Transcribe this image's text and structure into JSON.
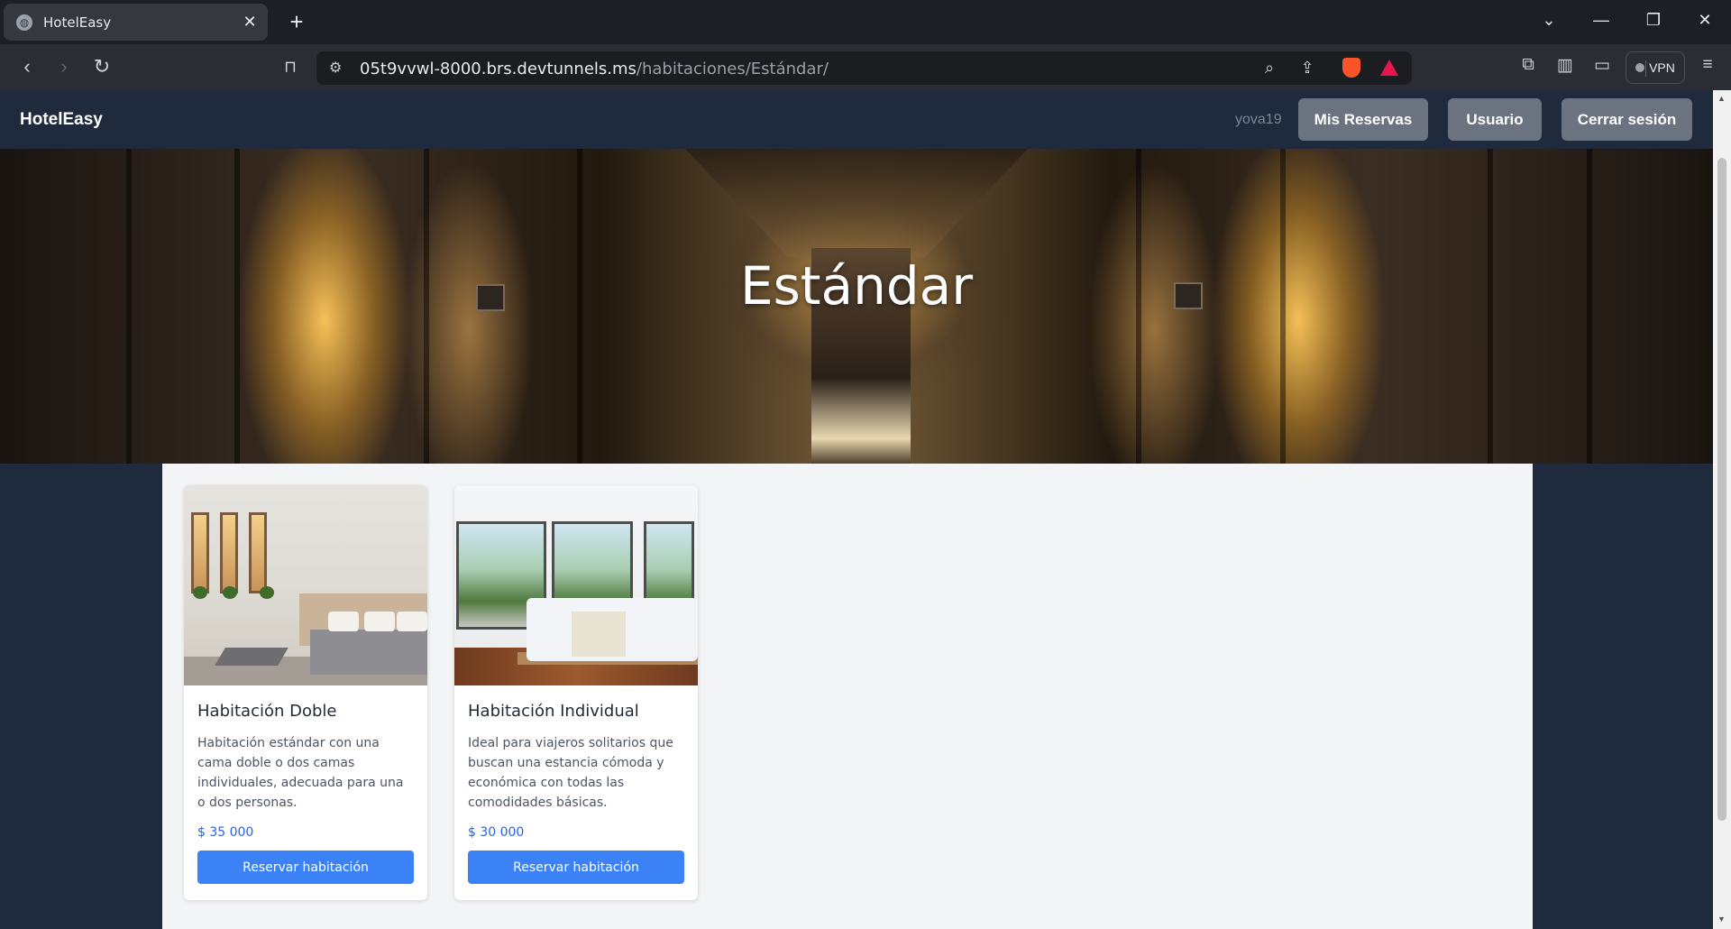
{
  "browser": {
    "tab_title": "HotelEasy",
    "url_host": "05t9vvwl-8000.brs.devtunnels.ms",
    "url_path": "/habitaciones/Estándar/",
    "vpn_label": "VPN"
  },
  "navbar": {
    "brand": "HotelEasy",
    "username": "yova19",
    "buttons": [
      "Mis Reservas",
      "Usuario",
      "Cerrar sesión"
    ]
  },
  "hero": {
    "title": "Estándar"
  },
  "rooms": [
    {
      "name": "Habitación Doble",
      "description": "Habitación estándar con una cama doble o dos camas individuales, adecuada para una o dos personas.",
      "price": "$ 35 000",
      "button": "Reservar habitación"
    },
    {
      "name": "Habitación Individual",
      "description": "Ideal para viajeros solitarios que buscan una estancia cómoda y económica con todas las comodidades básicas.",
      "price": "$ 30 000",
      "button": "Reservar habitación"
    }
  ],
  "colors": {
    "navbar_bg": "#1f2a3c",
    "nav_button_bg": "#6b7280",
    "content_bg": "#f3f4f6",
    "price": "#2563eb",
    "primary_button": "#3b82f6"
  }
}
